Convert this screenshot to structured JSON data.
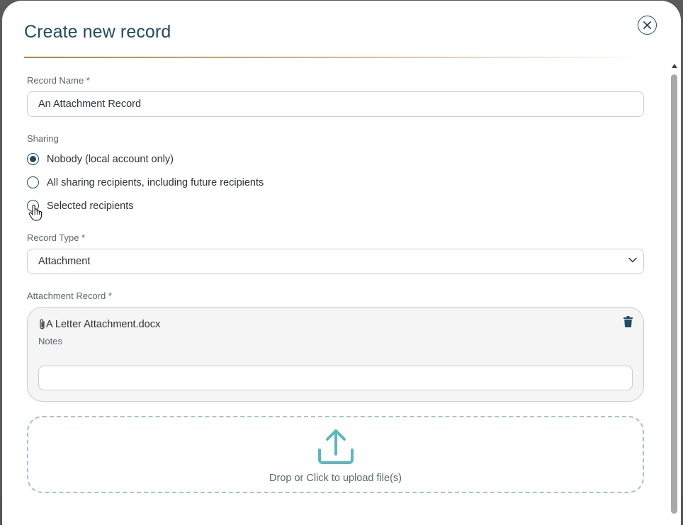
{
  "dialog": {
    "title": "Create new record",
    "close_icon": "close-icon"
  },
  "record_name": {
    "label": "Record Name *",
    "value": "An Attachment Record"
  },
  "sharing": {
    "label": "Sharing",
    "options": [
      {
        "label": "Nobody (local account only)",
        "selected": true
      },
      {
        "label": "All sharing recipients, including future recipients",
        "selected": false
      },
      {
        "label": "Selected recipients",
        "selected": false
      }
    ]
  },
  "record_type": {
    "label": "Record Type *",
    "value": "Attachment",
    "icon": "chevron-down-icon"
  },
  "attachment": {
    "label": "Attachment Record *",
    "file_name": "A Letter Attachment.docx",
    "file_icon": "paperclip-icon",
    "delete_icon": "trash-icon",
    "notes_label": "Notes",
    "notes_value": ""
  },
  "upload": {
    "text": "Drop or Click to upload file(s)",
    "icon": "upload-icon"
  },
  "colors": {
    "primary": "#1f4b63",
    "accent_rule": "#b0814a",
    "upload_icon": "#5bb7bd"
  }
}
